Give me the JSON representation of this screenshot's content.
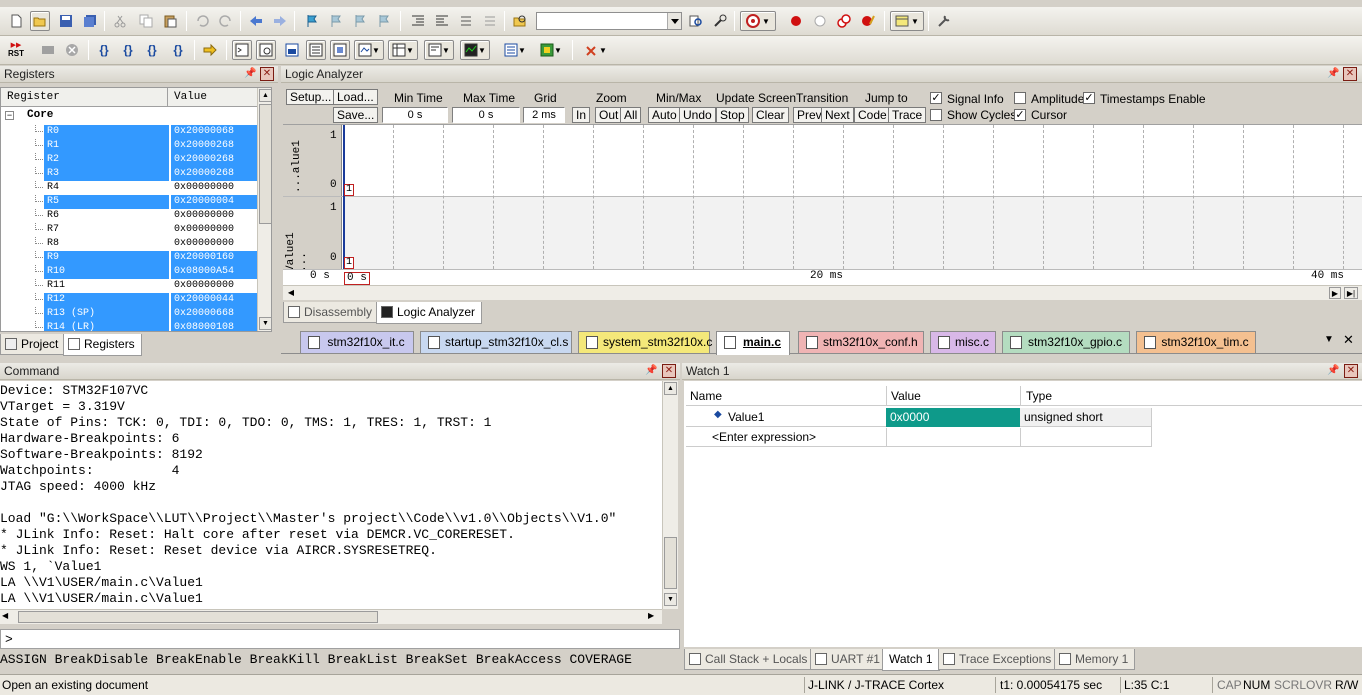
{
  "toolbar": {
    "build_target_value": "",
    "icons": [
      "new-file-icon",
      "open-folder-icon",
      "save-icon",
      "save-all-icon",
      "cut-icon",
      "copy-icon",
      "paste-icon",
      "undo-icon",
      "redo-icon",
      "nav-back-icon",
      "nav-forward-icon",
      "bookmark-icon",
      "prev-bookmark-icon",
      "next-bookmark-icon",
      "clear-bookmarks-icon",
      "indent-icon",
      "unindent-icon",
      "comment-icon",
      "uncomment-icon",
      "find-in-files-icon",
      "find-icon",
      "debug-icon",
      "breakpoint-icon",
      "disable-breakpoint-icon",
      "disable-all-breakpoints-icon",
      "kill-breakpoints-icon",
      "window-layout-icon",
      "configure-icon"
    ]
  },
  "debug_toolbar": {
    "rst_label": "RST",
    "icons": [
      "reset-icon",
      "stop-icon",
      "step-into-icon",
      "step-over-icon",
      "step-out-icon",
      "run-to-cursor-icon",
      "show-next-statement-icon",
      "command-window-icon",
      "disassembly-window-icon",
      "symbols-window-icon",
      "registers-window-icon",
      "call-stack-icon",
      "watch-windows-icon",
      "memory-windows-icon",
      "serial-windows-icon",
      "analysis-windows-icon",
      "trace-windows-icon",
      "system-viewer-icon",
      "toolbox-icon"
    ]
  },
  "registers": {
    "title": "Registers",
    "col_register": "Register",
    "col_value": "Value",
    "group": "Core",
    "rows": [
      {
        "name": "R0",
        "value": "0x20000068",
        "selected": true
      },
      {
        "name": "R1",
        "value": "0x20000268",
        "selected": true
      },
      {
        "name": "R2",
        "value": "0x20000268",
        "selected": true
      },
      {
        "name": "R3",
        "value": "0x20000268",
        "selected": true
      },
      {
        "name": "R4",
        "value": "0x00000000",
        "selected": false
      },
      {
        "name": "R5",
        "value": "0x20000004",
        "selected": true
      },
      {
        "name": "R6",
        "value": "0x00000000",
        "selected": false
      },
      {
        "name": "R7",
        "value": "0x00000000",
        "selected": false
      },
      {
        "name": "R8",
        "value": "0x00000000",
        "selected": false
      },
      {
        "name": "R9",
        "value": "0x20000160",
        "selected": true
      },
      {
        "name": "R10",
        "value": "0x08000A54",
        "selected": true
      },
      {
        "name": "R11",
        "value": "0x00000000",
        "selected": false
      },
      {
        "name": "R12",
        "value": "0x20000044",
        "selected": true
      },
      {
        "name": "R13 (SP)",
        "value": "0x20000668",
        "selected": true
      },
      {
        "name": "R14 (LR)",
        "value": "0x08000108",
        "selected": true
      }
    ],
    "tabs": [
      "Project",
      "Registers"
    ]
  },
  "logic_analyzer": {
    "title": "Logic Analyzer",
    "setup": "Setup...",
    "load": "Load...",
    "save": "Save...",
    "min_time_label": "Min Time",
    "min_time": "0 s",
    "max_time_label": "Max Time",
    "max_time": "0 s",
    "grid_label": "Grid",
    "grid": "2 ms",
    "zoom_label": "Zoom",
    "zoom_in": "In",
    "zoom_out": "Out",
    "zoom_all": "All",
    "minmax_label": "Min/Max",
    "auto": "Auto",
    "undo": "Undo",
    "update_label": "Update Screen",
    "stop": "Stop",
    "clear": "Clear",
    "transition_label": "Transition",
    "prev": "Prev",
    "next": "Next",
    "jump_label": "Jump to",
    "code": "Code",
    "trace": "Trace",
    "signal_info": "Signal Info",
    "show_cycles": "Show Cycles",
    "amplitude": "Amplitude",
    "cursor": "Cursor",
    "timestamps": "Timestamps Enable",
    "signal1_label": "...alue1",
    "signal2_label": "Value1 ...",
    "y_high": "1",
    "y_low": "0",
    "marker": "1",
    "t_left": "0 s",
    "t_cursor": "0 s",
    "t_mid": "20 ms",
    "t_right": "40 ms",
    "tabs": [
      "Disassembly",
      "Logic Analyzer"
    ]
  },
  "file_tabs": [
    {
      "name": "stm32f10x_it.c",
      "color": "#c8c8ee"
    },
    {
      "name": "startup_stm32f10x_cl.s",
      "color": "#c8d8f0"
    },
    {
      "name": "system_stm32f10x.c",
      "color": "#f4e87a"
    },
    {
      "name": "main.c",
      "color": "#ffffff",
      "active": true
    },
    {
      "name": "stm32f10x_conf.h",
      "color": "#f0b4b4"
    },
    {
      "name": "misc.c",
      "color": "#d8b8e8"
    },
    {
      "name": "stm32f10x_gpio.c",
      "color": "#b4dcc0"
    },
    {
      "name": "stm32f10x_tim.c",
      "color": "#f4c090"
    }
  ],
  "command": {
    "title": "Command",
    "lines": [
      "Device: STM32F107VC",
      "VTarget = 3.319V",
      "State of Pins: TCK: 0, TDI: 0, TDO: 0, TMS: 1, TRES: 1, TRST: 1",
      "Hardware-Breakpoints: 6",
      "Software-Breakpoints: 8192",
      "Watchpoints:          4",
      "JTAG speed: 4000 kHz",
      "",
      "Load \"G:\\\\WorkSpace\\\\LUT\\\\Project\\\\Master's project\\\\Code\\\\v1.0\\\\Objects\\\\V1.0\"",
      "* JLink Info: Reset: Halt core after reset via DEMCR.VC_CORERESET.",
      "* JLink Info: Reset: Reset device via AIRCR.SYSRESETREQ.",
      "WS 1, `Value1",
      "LA \\\\V1\\USER/main.c\\Value1",
      "LA \\\\V1\\USER/main.c\\Value1"
    ],
    "prompt": ">",
    "hints": "ASSIGN BreakDisable BreakEnable BreakKill BreakList BreakSet BreakAccess COVERAGE"
  },
  "watch": {
    "title": "Watch 1",
    "col_name": "Name",
    "col_value": "Value",
    "col_type": "Type",
    "rows": [
      {
        "name": "Value1",
        "value": "0x0000",
        "type": "unsigned short"
      }
    ],
    "enter_expression": "<Enter expression>",
    "tabs": [
      "Call Stack + Locals",
      "UART #1",
      "Watch 1",
      "Trace Exceptions",
      "Memory 1"
    ]
  },
  "status": {
    "left": "Open an existing document",
    "debugger": "J-LINK / J-TRACE Cortex",
    "time": "t1: 0.00054175 sec",
    "position": "L:35 C:1",
    "cap": "CAP",
    "num": "NUM",
    "scrl": "SCRL",
    "ovr": "OVR",
    "rw": "R/W"
  }
}
